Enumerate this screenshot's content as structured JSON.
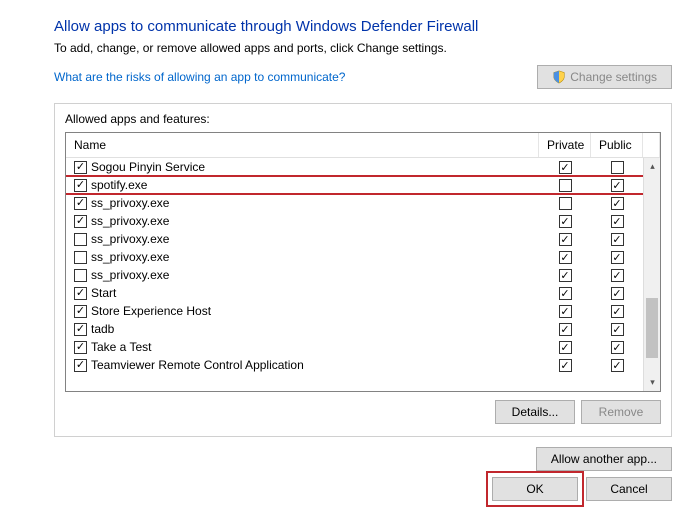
{
  "title": "Allow apps to communicate through Windows Defender Firewall",
  "subtitle": "To add, change, or remove allowed apps and ports, click Change settings.",
  "risk_link": "What are the risks of allowing an app to communicate?",
  "change_settings_label": "Change settings",
  "group_label": "Allowed apps and features:",
  "columns": {
    "name": "Name",
    "private": "Private",
    "public": "Public"
  },
  "rows": [
    {
      "enabled": true,
      "name": "Sogou Pinyin Service",
      "private": true,
      "public": false
    },
    {
      "enabled": true,
      "name": "spotify.exe",
      "private": false,
      "public": true,
      "highlighted": true
    },
    {
      "enabled": true,
      "name": "ss_privoxy.exe",
      "private": false,
      "public": true
    },
    {
      "enabled": true,
      "name": "ss_privoxy.exe",
      "private": true,
      "public": true
    },
    {
      "enabled": false,
      "name": "ss_privoxy.exe",
      "private": true,
      "public": true
    },
    {
      "enabled": false,
      "name": "ss_privoxy.exe",
      "private": true,
      "public": true
    },
    {
      "enabled": false,
      "name": "ss_privoxy.exe",
      "private": true,
      "public": true
    },
    {
      "enabled": true,
      "name": "Start",
      "private": true,
      "public": true
    },
    {
      "enabled": true,
      "name": "Store Experience Host",
      "private": true,
      "public": true
    },
    {
      "enabled": true,
      "name": "tadb",
      "private": true,
      "public": true
    },
    {
      "enabled": true,
      "name": "Take a Test",
      "private": true,
      "public": true
    },
    {
      "enabled": true,
      "name": "Teamviewer Remote Control Application",
      "private": true,
      "public": true
    }
  ],
  "details_label": "Details...",
  "remove_label": "Remove",
  "allow_another_label": "Allow another app...",
  "ok_label": "OK",
  "cancel_label": "Cancel"
}
